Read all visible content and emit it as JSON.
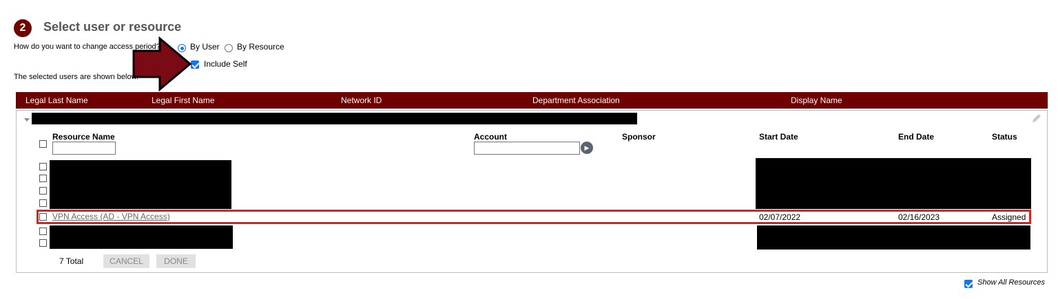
{
  "step": {
    "number": "2",
    "title": "Select user or resource"
  },
  "question": "How do you want to change access period?",
  "options": {
    "by_user": "By User",
    "by_resource": "By Resource",
    "selected": "by_user"
  },
  "include_self": {
    "label": "Include Self",
    "checked": true
  },
  "shown_note": "The selected users are shown below.",
  "user_columns": [
    "Legal Last Name",
    "Legal First Name",
    "Network ID",
    "Department Association",
    "Display Name"
  ],
  "resource_columns": {
    "resource_name": "Resource Name",
    "account": "Account",
    "sponsor": "Sponsor",
    "start_date": "Start Date",
    "end_date": "End Date",
    "status": "Status"
  },
  "highlighted_row": {
    "resource": "VPN Access (AD - VPN Access)",
    "start_date": "02/07/2022",
    "end_date": "02/16/2023",
    "status": "Assigned"
  },
  "footer": {
    "total": "7 Total",
    "cancel": "CANCEL",
    "done": "DONE"
  },
  "show_all_resources": {
    "label": "Show All Resources",
    "checked": true
  },
  "colors": {
    "header": "#6e0000",
    "accent": "#1a73e8",
    "highlight": "#e0201e",
    "arrow": "#7a0a14"
  }
}
